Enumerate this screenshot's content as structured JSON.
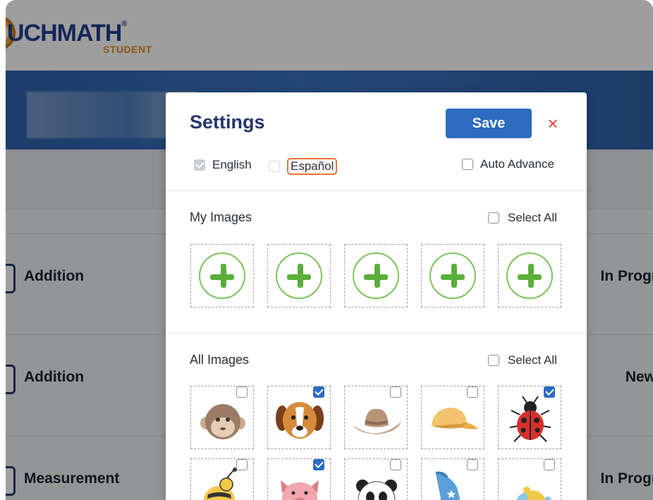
{
  "app": {
    "logo_text": "UCHMATH",
    "logo_reg": "®",
    "logo_sub": "STUDENT"
  },
  "lessons": [
    {
      "name": "Addition",
      "status": "In Progr"
    },
    {
      "name": "Addition",
      "status": "New"
    },
    {
      "name": "Measurement",
      "status": "In Progr"
    }
  ],
  "modal": {
    "title": "Settings",
    "save_label": "Save",
    "close_glyph": "×",
    "languages": [
      {
        "label": "English",
        "checked": true
      },
      {
        "label": "Español",
        "checked": false
      }
    ],
    "auto_advance": {
      "label": "Auto Advance",
      "checked": false
    },
    "my_images": {
      "title": "My Images",
      "select_all_label": "Select All"
    },
    "all_images": {
      "title": "All Images",
      "select_all_label": "Select All",
      "items": [
        {
          "icon": "monkey-icon",
          "checked": false
        },
        {
          "icon": "dog-icon",
          "checked": true
        },
        {
          "icon": "cowboy-hat-icon",
          "checked": false
        },
        {
          "icon": "cap-icon",
          "checked": false
        },
        {
          "icon": "ladybug-icon",
          "checked": true
        },
        {
          "icon": "bee-icon",
          "checked": false
        },
        {
          "icon": "pig-icon",
          "checked": true
        },
        {
          "icon": "panda-icon",
          "checked": false
        },
        {
          "icon": "wizard-hat-icon",
          "checked": false
        },
        {
          "icon": "jester-hat-icon",
          "checked": false
        }
      ]
    }
  },
  "colors": {
    "primary": "#2c6cc0",
    "title": "#24356b",
    "close": "#e0453d",
    "highlight": "#e8743b",
    "plus_green": "#5aae3a"
  }
}
